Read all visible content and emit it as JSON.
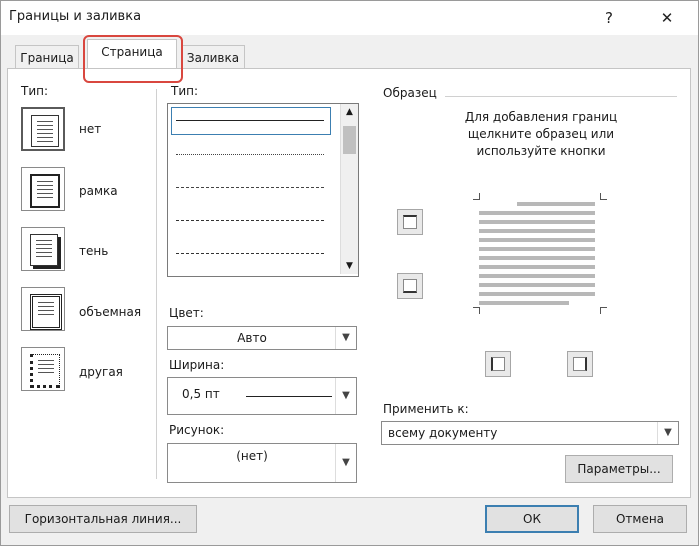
{
  "window": {
    "title": "Границы и заливка",
    "help": "?",
    "close": "✕"
  },
  "tabs": [
    {
      "label": "Граница"
    },
    {
      "label": "Страница"
    },
    {
      "label": "Заливка"
    }
  ],
  "type_section": {
    "label": "Тип:",
    "options": [
      {
        "label": "нет",
        "icon": "page-none-icon"
      },
      {
        "label": "рамка",
        "icon": "page-box-icon"
      },
      {
        "label": "тень",
        "icon": "page-shadow-icon"
      },
      {
        "label": "объемная",
        "icon": "page-3d-icon"
      },
      {
        "label": "другая",
        "icon": "page-custom-icon"
      }
    ]
  },
  "style_section": {
    "label": "Тип:"
  },
  "color": {
    "label": "Цвет:",
    "value": "Авто"
  },
  "width": {
    "label": "Ширина:",
    "value": "0,5 пт"
  },
  "art": {
    "label": "Рисунок:",
    "value": "(нет)"
  },
  "preview": {
    "label": "Образец",
    "hint": [
      "Для добавления границ",
      "щелкните образец или",
      "используйте кнопки"
    ]
  },
  "apply_to": {
    "label": "Применить к:",
    "value": "всему документу"
  },
  "buttons": {
    "options": "Параметры...",
    "horizontal_line": "Горизонтальная линия...",
    "ok": "ОК",
    "cancel": "Отмена"
  }
}
